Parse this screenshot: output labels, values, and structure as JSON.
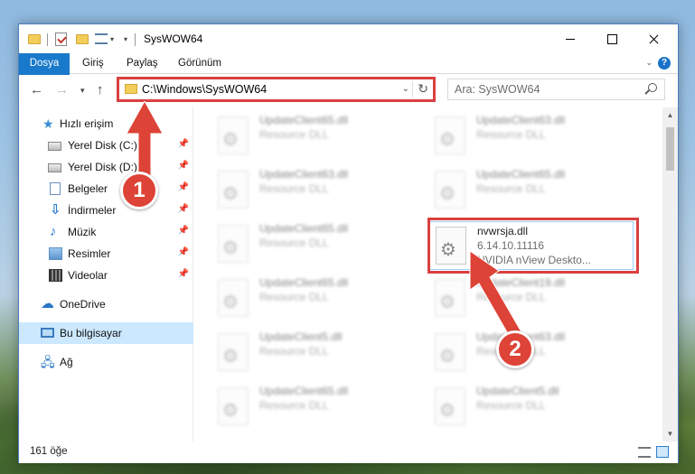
{
  "window": {
    "title": "SysWOW64"
  },
  "ribbon": {
    "tabs": [
      "Dosya",
      "Giriş",
      "Paylaş",
      "Görünüm"
    ],
    "help_label": "?"
  },
  "navigation": {
    "address": "C:\\Windows\\SysWOW64",
    "search_placeholder": "Ara: SysWOW64"
  },
  "sidebar": {
    "items": [
      {
        "label": "Hızlı erişim",
        "icon": "star-icon"
      },
      {
        "label": "Yerel Disk (C:)",
        "icon": "disk-icon",
        "pinned": true
      },
      {
        "label": "Yerel Disk (D:)",
        "icon": "disk-icon",
        "pinned": true
      },
      {
        "label": "Belgeler",
        "icon": "document-icon",
        "pinned": true
      },
      {
        "label": "İndirmeler",
        "icon": "download-icon",
        "pinned": true
      },
      {
        "label": "Müzik",
        "icon": "music-icon",
        "pinned": true
      },
      {
        "label": "Resimler",
        "icon": "pictures-icon",
        "pinned": true
      },
      {
        "label": "Videolar",
        "icon": "video-icon",
        "pinned": true
      },
      {
        "label": "OneDrive",
        "icon": "cloud-icon"
      },
      {
        "label": "Bu bilgisayar",
        "icon": "computer-icon",
        "selected": true
      },
      {
        "label": "Ağ",
        "icon": "network-icon"
      }
    ]
  },
  "files": [
    {
      "name": "UpdateClient65.dll",
      "type": "Resource DLL"
    },
    {
      "name": "UpdateClient63.dll",
      "type": "Resource DLL"
    },
    {
      "name": "UpdateClient63.dll",
      "type": "Resource DLL"
    },
    {
      "name": "UpdateClient65.dll",
      "type": "Resource DLL"
    },
    {
      "name": "UpdateClient65.dll",
      "type": "Resource DLL"
    },
    {
      "name": "nvwrsja.dll",
      "version": "6.14.10.11116",
      "description": "NVIDIA nView Deskto...",
      "highlighted": true
    },
    {
      "name": "UpdateClient65.dll",
      "type": "Resource DLL"
    },
    {
      "name": "UpdateClient19.dll",
      "type": "Resource DLL"
    },
    {
      "name": "UpdateClient5.dll",
      "type": "Resource DLL"
    },
    {
      "name": "UpdateClient63.dll",
      "type": "Resource DLL"
    },
    {
      "name": "UpdateClient65.dll",
      "type": "Resource DLL"
    },
    {
      "name": "UpdateClient5.dll",
      "type": "Resource DLL"
    }
  ],
  "status": {
    "item_count": "161 öğe"
  },
  "annotations": {
    "step1": "1",
    "step2": "2",
    "accent_color": "#dd4336"
  }
}
